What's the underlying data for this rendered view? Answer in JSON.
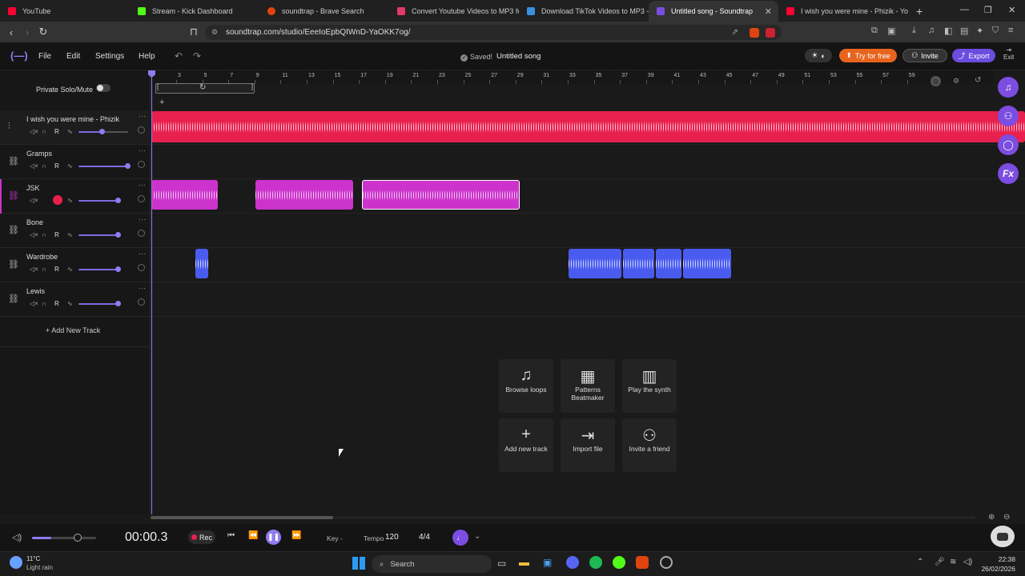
{
  "browser": {
    "tabs": [
      {
        "label": "YouTube",
        "color": "#ff0033"
      },
      {
        "label": "Stream - Kick Dashboard",
        "color": "#53fc18"
      },
      {
        "label": "soundtrap - Brave Search",
        "color": "#e0440e"
      },
      {
        "label": "Convert Youtube Videos to MP3 for",
        "color": "#e03a6a"
      },
      {
        "label": "Download TikTok Videos to MP3 - Fr",
        "color": "#3b8fe0"
      },
      {
        "label": "Untitled song - Soundtrap",
        "color": "#7b4de0"
      },
      {
        "label": "I wish you were mine - Phizik - YouT",
        "color": "#ff0033"
      }
    ],
    "url": "soundtrap.com/studio/EeeIoEpbQIWnD-YaOKK7og/"
  },
  "app": {
    "menu": [
      "File",
      "Edit",
      "Settings",
      "Help"
    ],
    "saved": "Saved!",
    "song_title": "Untitled song",
    "try_free": "Try for free",
    "invite": "Invite",
    "export": "Export",
    "exit": "Exit",
    "private_solo": "Private Solo/Mute",
    "add_track": "Add New Track"
  },
  "ruler_ticks": [
    "3",
    "5",
    "7",
    "9",
    "11",
    "13",
    "15",
    "17",
    "19",
    "21",
    "23",
    "25",
    "27",
    "29",
    "31",
    "33",
    "35",
    "37",
    "39",
    "41",
    "43",
    "45",
    "47",
    "49",
    "51",
    "53",
    "55",
    "57",
    "59"
  ],
  "tracks": [
    {
      "name": "I wish you were mine - Phizik",
      "color": "#e8204e"
    },
    {
      "name": "Gramps",
      "color": "#cc33cc"
    },
    {
      "name": "JSK",
      "color": "#cc33cc"
    },
    {
      "name": "Bone",
      "color": "#cc33cc"
    },
    {
      "name": "Wardrobe",
      "color": "#4a5cf0"
    },
    {
      "name": "Lewis",
      "color": "#4a5cf0"
    }
  ],
  "tiles": [
    {
      "label": "Browse loops",
      "icon": "music-note-icon"
    },
    {
      "label": "Patterns Beatmaker",
      "icon": "grid-icon"
    },
    {
      "label": "Play the synth",
      "icon": "piano-icon"
    },
    {
      "label": "Add new track",
      "icon": "plus-icon"
    },
    {
      "label": "Import file",
      "icon": "import-icon"
    },
    {
      "label": "Invite a friend",
      "icon": "add-user-icon"
    }
  ],
  "transport": {
    "time": "00:00.3",
    "rec": "Rec",
    "key_label": "Key",
    "key_value": "-",
    "tempo_label": "Tempo",
    "tempo_value": "120",
    "signature": "4/4"
  },
  "taskbar": {
    "temp": "11°C",
    "weather": "Light rain",
    "search": "Search",
    "time": "22:38",
    "date": "26/02/2026"
  },
  "colors": {
    "accent": "#7b4de0",
    "export": "#6b4de0",
    "try_free": "#e8641e"
  }
}
